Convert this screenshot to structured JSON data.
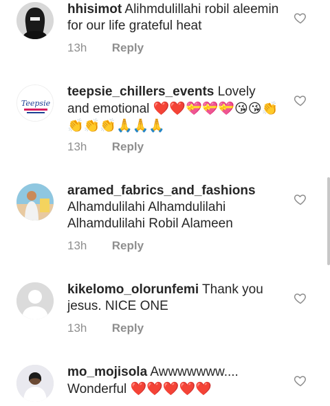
{
  "comments": [
    {
      "username": "hhisimot",
      "text": "Alihmdulillahi robil aleemin for our life grateful heat",
      "time": "13h",
      "reply": "Reply"
    },
    {
      "username": "teepsie_chillers_events",
      "text": "Lovely and emotional",
      "emoji": "❤️❤️💝💝💝😘😘👏👏👏👏🙏🙏🙏",
      "time": "13h",
      "reply": "Reply",
      "avatar_text": "Teepsie"
    },
    {
      "username": "aramed_fabrics_and_fashions",
      "text": "Alhamdulilahi Alhamdulilahi Alhamdulilahi Robil Alameen",
      "time": "13h",
      "reply": "Reply"
    },
    {
      "username": "kikelomo_olorunfemi",
      "text": "Thank you jesus. NICE ONE",
      "time": "13h",
      "reply": "Reply"
    },
    {
      "username": "mo_mojisola",
      "text": "Awwwwwww.... Wonderful",
      "emoji": "❤️❤️❤️❤️❤️",
      "time": "",
      "reply": ""
    }
  ],
  "colors": {
    "text": "#262626",
    "muted": "#8e8e8e",
    "heart": "#e0245e",
    "scrollbar": "#c7c7c7"
  }
}
